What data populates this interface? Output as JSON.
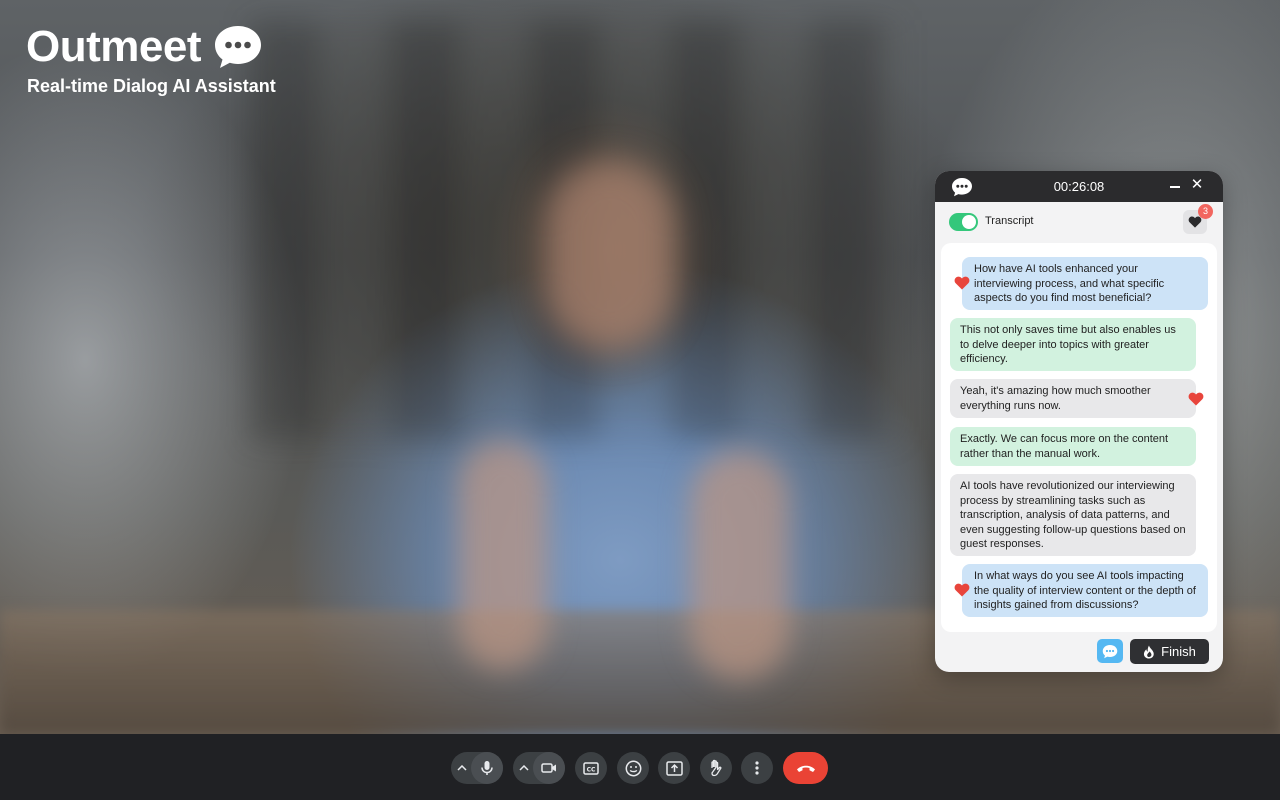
{
  "brand": {
    "name": "Outmeet",
    "tagline": "Real-time Dialog AI Assistant"
  },
  "panel": {
    "timer": "00:26:08",
    "transcript_label": "Transcript",
    "transcript_enabled": true,
    "favorites_count": "3",
    "finish_label": "Finish",
    "messages": [
      {
        "kind": "question",
        "favorited": true,
        "text": "How have AI tools enhanced your interviewing process, and what specific aspects do you find most beneficial?"
      },
      {
        "kind": "suggestion",
        "favorited": false,
        "text": "This not only saves time but also enables us to delve deeper into topics with greater efficiency."
      },
      {
        "kind": "transcript",
        "favorited": true,
        "text": "Yeah, it's amazing how much smoother everything runs now."
      },
      {
        "kind": "suggestion",
        "favorited": false,
        "text": "Exactly. We can focus more on the content rather than the manual work."
      },
      {
        "kind": "transcript",
        "favorited": false,
        "text": "AI tools have revolutionized our interviewing process by streamlining tasks such as transcription, analysis of data patterns, and even suggesting follow-up questions based on guest responses."
      },
      {
        "kind": "question",
        "favorited": true,
        "text": "In what ways do you see AI tools impacting the quality of interview content or the depth of insights gained from discussions?"
      }
    ]
  },
  "colors": {
    "accent_green": "#34c77b",
    "heart_red": "#e8453c",
    "end_call_red": "#ea4335",
    "chat_button_blue": "#55b8f2"
  },
  "controls": {
    "icons": [
      "chevron-up-icon",
      "microphone-icon",
      "chevron-up-icon",
      "camera-icon",
      "captions-icon",
      "emoji-icon",
      "present-screen-icon",
      "raise-hand-icon",
      "more-options-icon",
      "end-call-icon"
    ]
  }
}
